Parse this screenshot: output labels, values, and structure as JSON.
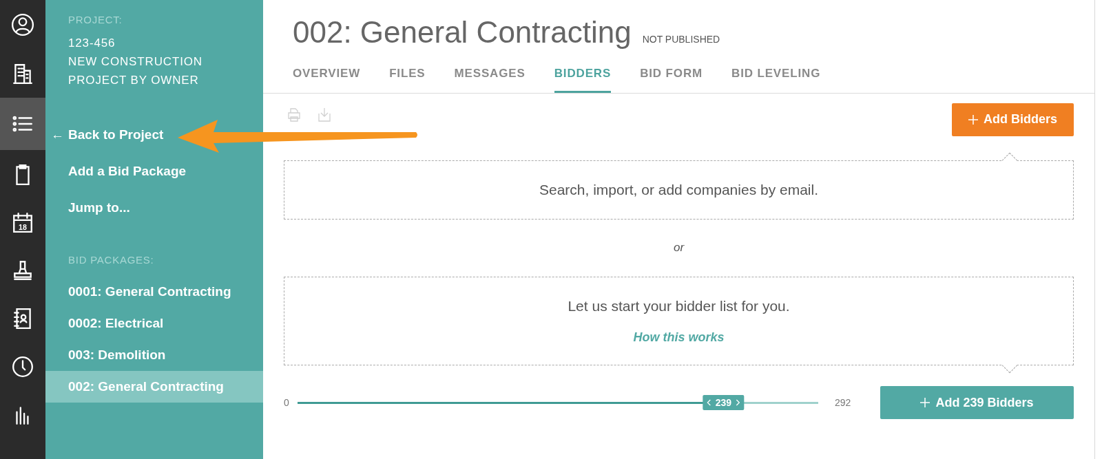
{
  "rail": {
    "items": [
      {
        "kind": "user",
        "selected": false
      },
      {
        "kind": "building",
        "selected": false
      },
      {
        "kind": "list",
        "selected": true
      },
      {
        "kind": "clipboard",
        "selected": false
      },
      {
        "kind": "calendar",
        "selected": false,
        "label": "18"
      },
      {
        "kind": "stamp",
        "selected": false
      },
      {
        "kind": "contacts",
        "selected": false
      },
      {
        "kind": "clock",
        "selected": false
      },
      {
        "kind": "chart",
        "selected": false
      }
    ]
  },
  "sidebar": {
    "project_label": "PROJECT:",
    "project_lines": [
      "123-456",
      "NEW CONSTRUCTION",
      "PROJECT BY OWNER"
    ],
    "links": [
      {
        "arrow": "←",
        "label": "Back to Project"
      },
      {
        "label": "Add a Bid Package"
      },
      {
        "label": "Jump to..."
      }
    ],
    "packages_label": "BID PACKAGES:",
    "packages": [
      {
        "label": "0001: General Contracting",
        "selected": false
      },
      {
        "label": "0002: Electrical",
        "selected": false
      },
      {
        "label": "003: Demolition",
        "selected": false
      },
      {
        "label": "002: General Contracting",
        "selected": true
      }
    ]
  },
  "header": {
    "title": "002: General Contracting",
    "status": "NOT PUBLISHED"
  },
  "tabs": [
    {
      "label": "OVERVIEW",
      "selected": false
    },
    {
      "label": "FILES",
      "selected": false
    },
    {
      "label": "MESSAGES",
      "selected": false
    },
    {
      "label": "BIDDERS",
      "selected": true
    },
    {
      "label": "BID FORM",
      "selected": false
    },
    {
      "label": "BID LEVELING",
      "selected": false
    }
  ],
  "add_bidders_button": "Add Bidders",
  "search_box": "Search, import, or add companies by email.",
  "or_text": "or",
  "suggest_box": {
    "text": "Let us start your bidder list for you.",
    "link": "How this works"
  },
  "slider": {
    "min": "0",
    "max": "292",
    "value": "239",
    "level": 0.818
  },
  "add_count_button": "Add 239 Bidders",
  "annotation": {
    "kind": "arrow"
  }
}
